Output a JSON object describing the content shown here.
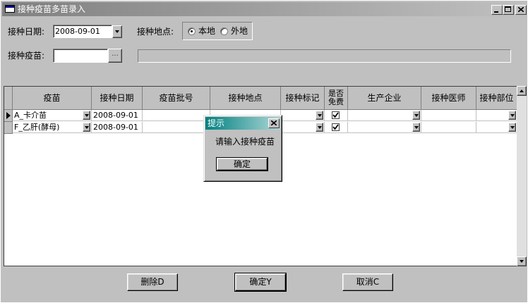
{
  "window": {
    "title": "接种疫苗多苗录入"
  },
  "form": {
    "date_label": "接种日期:",
    "date_value": "2008-09-01",
    "location_label": "接种地点:",
    "location_options": [
      "本地",
      "外地"
    ],
    "location_selected": "本地",
    "vaccine_label": "接种疫苗:",
    "vaccine_value": "",
    "browse_label": "...",
    "vaccine_display": ""
  },
  "grid": {
    "columns": [
      "疫苗",
      "接种日期",
      "疫苗批号",
      "接种地点",
      "接种标记",
      "是否免费",
      "生产企业",
      "接种医师",
      "接种部位"
    ],
    "rows": [
      {
        "vaccine": "A_卡介苗",
        "date": "2008-09-01",
        "batch": "",
        "location": "",
        "mark": "",
        "free": true,
        "manufacturer": "",
        "doctor": "",
        "site": "",
        "current": true
      },
      {
        "vaccine": "F_乙肝(酵母)",
        "date": "2008-09-01",
        "batch": "",
        "location": "",
        "mark": "",
        "free": true,
        "manufacturer": "",
        "doctor": "",
        "site": "",
        "current": false
      }
    ]
  },
  "buttons": {
    "delete": "删除D",
    "ok": "确定Y",
    "cancel": "取消C"
  },
  "dialog": {
    "title": "提示",
    "message": "请输入接种疫苗",
    "ok": "确定"
  },
  "colors": {
    "face": "#c0c0c0",
    "title_gradient_start": "#808080",
    "dialog_title_start": "#008080"
  }
}
